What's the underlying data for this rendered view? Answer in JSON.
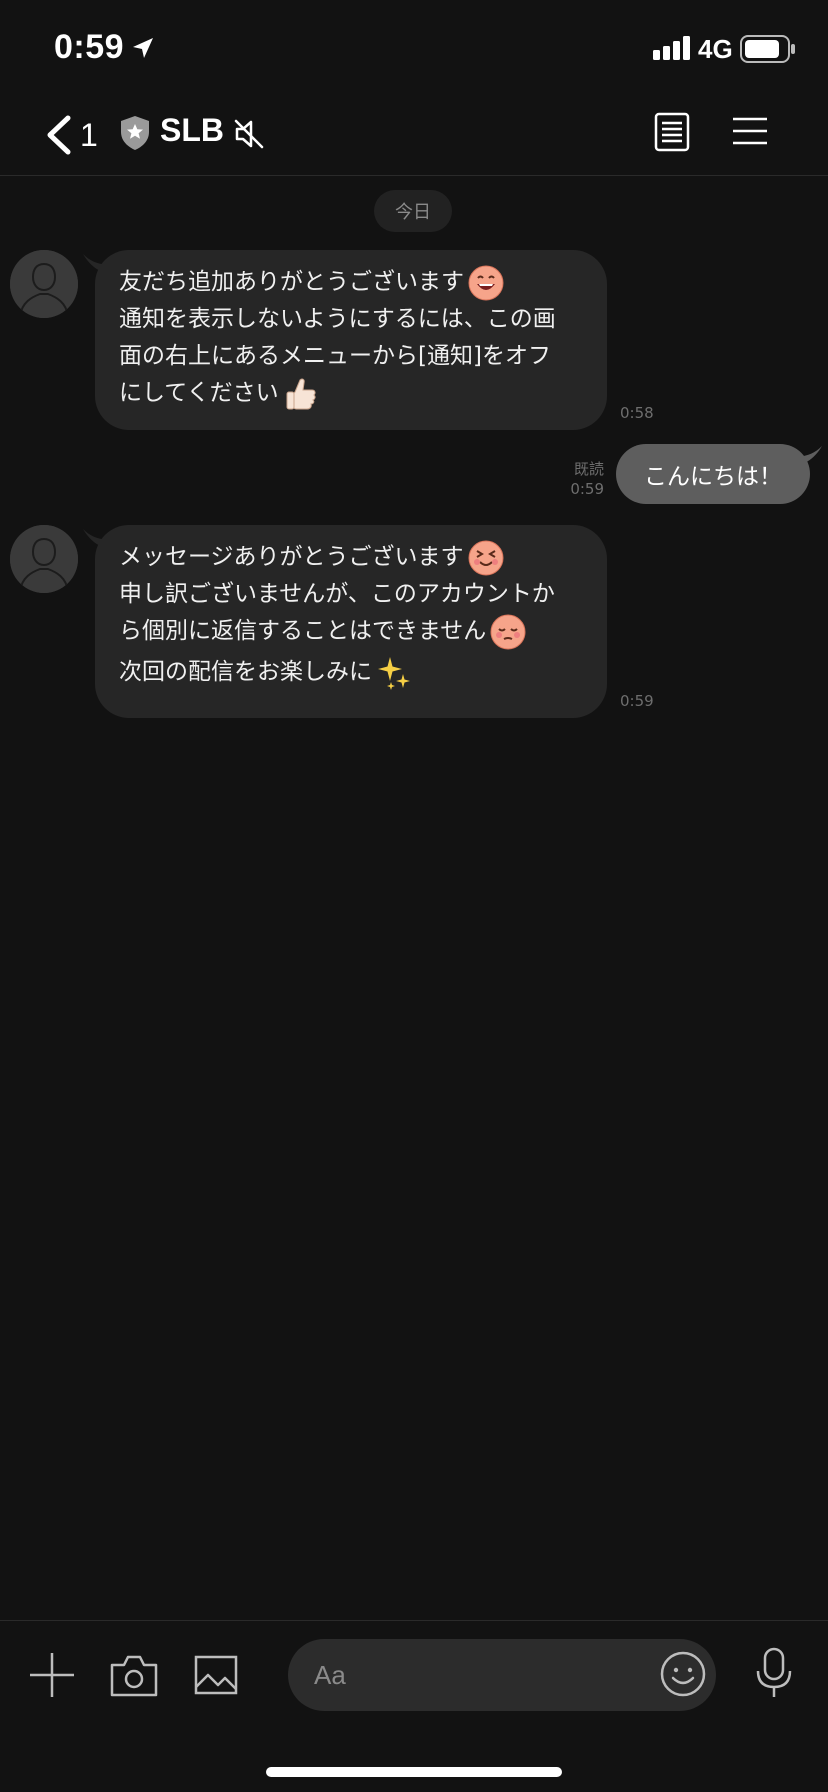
{
  "status_bar": {
    "time": "0:59",
    "network": "4G"
  },
  "header": {
    "back_count": "1",
    "title": "SLB"
  },
  "date_chip": "今日",
  "messages": [
    {
      "lines": [
        "友だち追加ありがとうございます",
        "通知を表示しないようにするには、この画",
        "面の右上にあるメニューから[通知]をオフ",
        "にしてください"
      ],
      "time": "0:58"
    },
    {
      "text": "こんにちは！",
      "read": "既読",
      "time": "0:59"
    },
    {
      "lines": [
        "メッセージありがとうございます",
        "申し訳ございませんが、このアカウントか",
        "ら個別に返信することはできません",
        "次回の配信をお楽しみに"
      ],
      "time": "0:59"
    }
  ],
  "input": {
    "placeholder": "Aa"
  },
  "icons": {
    "location": "location-arrow-icon",
    "signal": "signal-icon",
    "battery": "battery-icon",
    "back": "chevron-left-icon",
    "shield": "shield-star-icon",
    "mute": "speaker-muted-icon",
    "notes": "notes-icon",
    "menu": "hamburger-menu-icon",
    "plus": "plus-icon",
    "camera": "camera-icon",
    "gallery": "image-icon",
    "emoji": "smiley-icon",
    "mic": "microphone-icon"
  },
  "colors": {
    "background": "#121212",
    "bubble_in": "#262626",
    "bubble_out": "#5e5e5e"
  }
}
